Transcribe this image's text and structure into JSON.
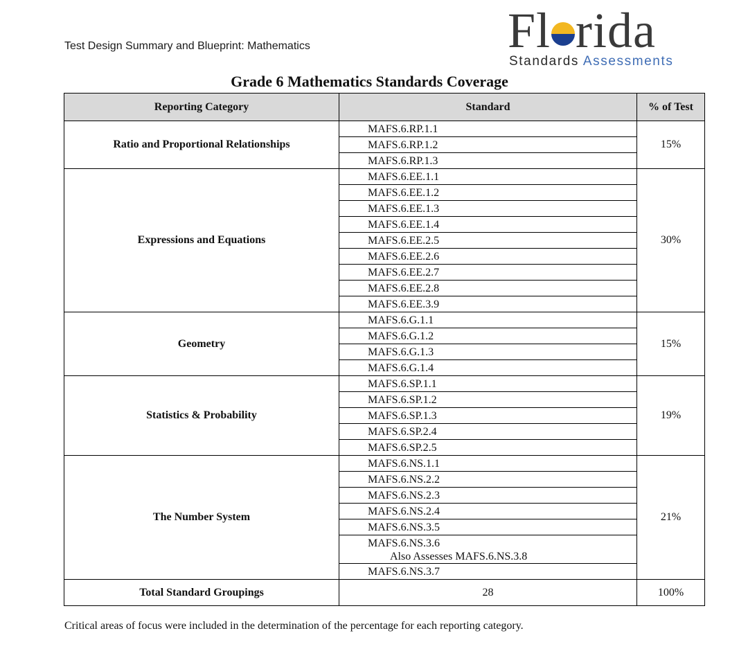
{
  "header": {
    "doc_title": "Test Design Summary and Blueprint: Mathematics",
    "logo": {
      "word_start": "Fl",
      "word_end": "rida",
      "icon": "sun-river-icon",
      "sub_dark": "Standards",
      "sub_blue": "Assessments",
      "colors": {
        "gold": "#f2b721",
        "navy": "#1b3f8f",
        "blue_text": "#3f6db5"
      }
    }
  },
  "title": "Grade 6 Mathematics Standards Coverage",
  "table": {
    "columns": [
      "Reporting Category",
      "Standard",
      "% of Test"
    ],
    "categories": [
      {
        "name": "Ratio and Proportional Relationships",
        "percent": "15%",
        "standards": [
          "MAFS.6.RP.1.1",
          "MAFS.6.RP.1.2",
          "MAFS.6.RP.1.3"
        ]
      },
      {
        "name": "Expressions and Equations",
        "percent": "30%",
        "standards": [
          "MAFS.6.EE.1.1",
          "MAFS.6.EE.1.2",
          "MAFS.6.EE.1.3",
          "MAFS.6.EE.1.4",
          "MAFS.6.EE.2.5",
          "MAFS.6.EE.2.6",
          "MAFS.6.EE.2.7",
          "MAFS.6.EE.2.8",
          "MAFS.6.EE.3.9"
        ]
      },
      {
        "name": "Geometry",
        "percent": "15%",
        "standards": [
          "MAFS.6.G.1.1",
          "MAFS.6.G.1.2",
          "MAFS.6.G.1.3",
          "MAFS.6.G.1.4"
        ]
      },
      {
        "name": "Statistics & Probability",
        "percent": "19%",
        "standards": [
          "MAFS.6.SP.1.1",
          "MAFS.6.SP.1.2",
          "MAFS.6.SP.1.3",
          "MAFS.6.SP.2.4",
          "MAFS.6.SP.2.5"
        ]
      },
      {
        "name": "The Number System",
        "percent": "21%",
        "standards": [
          "MAFS.6.NS.1.1",
          "MAFS.6.NS.2.2",
          "MAFS.6.NS.2.3",
          "MAFS.6.NS.2.4",
          "MAFS.6.NS.3.5",
          "MAFS.6.NS.3.6",
          "MAFS.6.NS.3.7"
        ],
        "notes": {
          "MAFS.6.NS.3.6": "Also Assesses MAFS.6.NS.3.8"
        }
      }
    ],
    "total": {
      "label": "Total Standard Groupings",
      "count": "28",
      "percent": "100%"
    }
  },
  "footnote": "Critical areas of focus were included in the determination of the percentage for each reporting category."
}
